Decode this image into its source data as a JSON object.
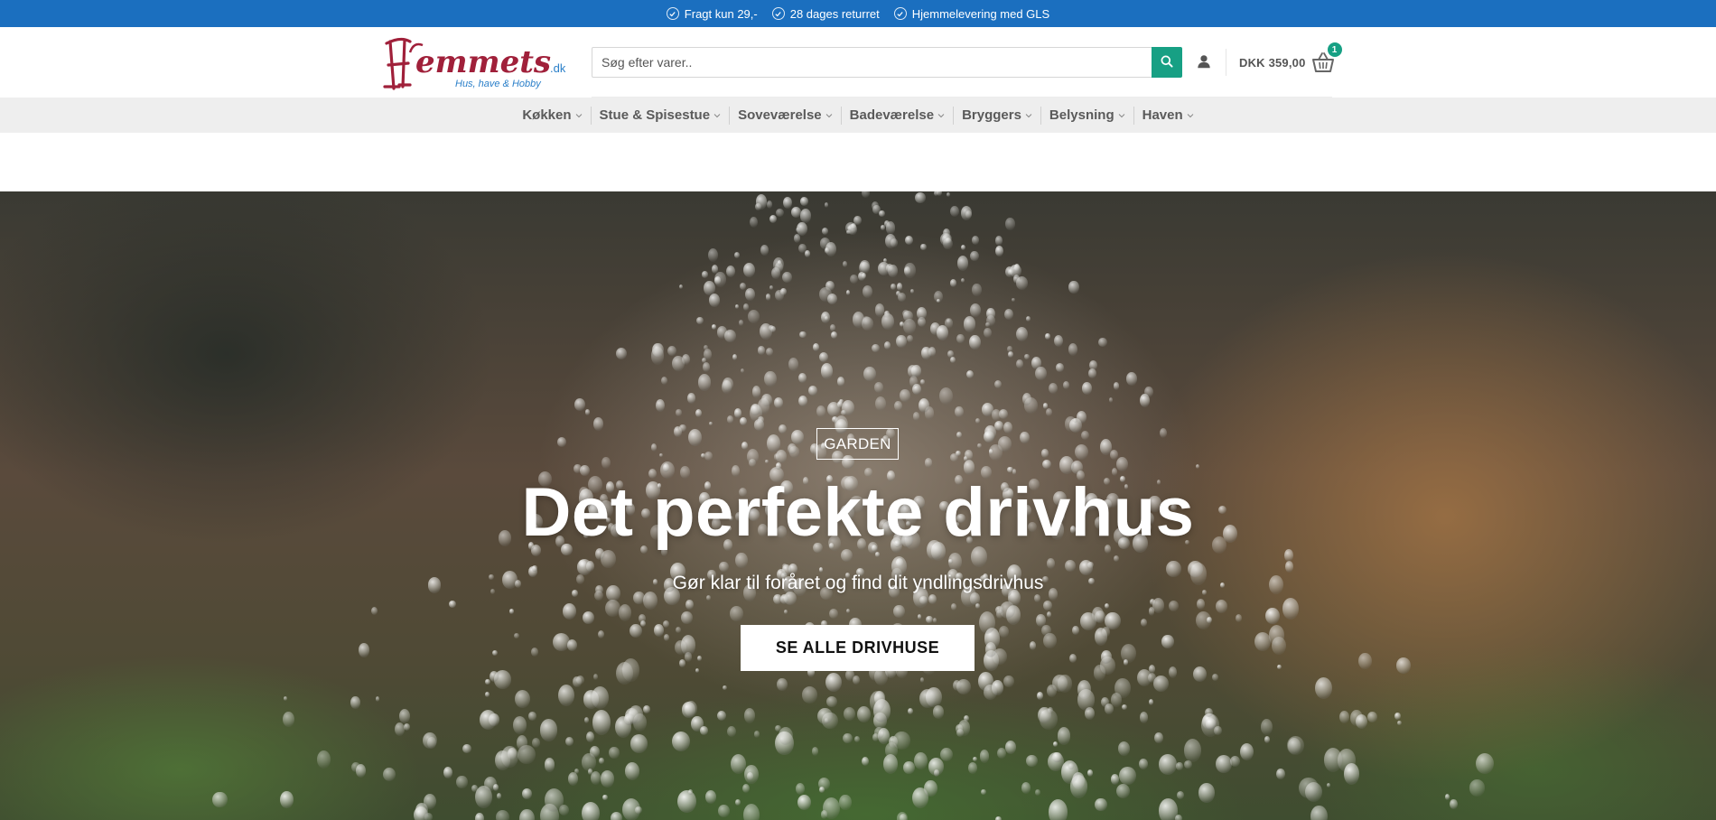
{
  "topbar": {
    "usps": [
      "Fragt kun 29,-",
      "28 dages returret",
      "Hjemmelevering med GLS"
    ]
  },
  "header": {
    "logo_text": "Hjemmets.dk",
    "logo_tagline": "Hus, have & Hobby",
    "search": {
      "placeholder": "Søg efter varer..",
      "value": ""
    },
    "cart": {
      "total": "DKK 359,00",
      "count": "1"
    }
  },
  "nav": {
    "items": [
      "Køkken",
      "Stue & Spisestue",
      "Soveværelse",
      "Badeværelse",
      "Bryggers",
      "Belysning",
      "Haven"
    ]
  },
  "hero": {
    "tag": "GARDEN",
    "headline": "Det perfekte drivhus",
    "subline": "Gør klar til foråret og find dit yndlingsdrivhus",
    "cta": "SE ALLE DRIVHUSE"
  },
  "colors": {
    "topbar": "#1b6fbf",
    "accent_green": "#17a084",
    "logo_red": "#a0203a",
    "logo_blue": "#2a7fc9",
    "nav_bg": "#eeeeee"
  },
  "icons": {
    "usp": "check-circle-icon",
    "search": "search-icon",
    "account": "user-icon",
    "cart": "basket-icon",
    "nav_dropdown": "chevron-down-icon"
  }
}
